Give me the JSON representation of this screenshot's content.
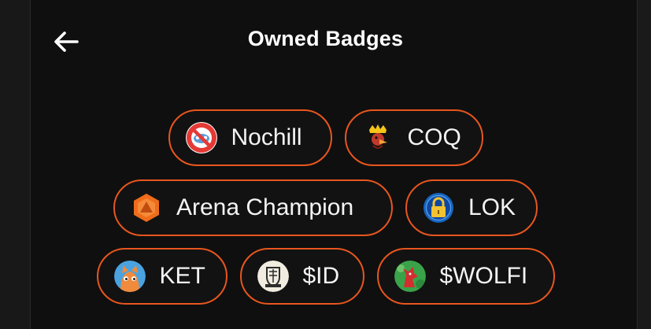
{
  "header": {
    "title": "Owned Badges",
    "back_icon": "arrow-left-icon"
  },
  "badges": [
    {
      "label": "Nochill",
      "icon": "nochill-logo-icon",
      "color": "#e53935"
    },
    {
      "label": "COQ",
      "icon": "crown-rooster-icon",
      "color": "#f5c518"
    },
    {
      "label": "Arena Champion",
      "icon": "arena-hexagon-icon",
      "color": "#ef6c1a"
    },
    {
      "label": "LOK",
      "icon": "padlock-icon",
      "color": "#1565c0"
    },
    {
      "label": "KET",
      "icon": "ket-mascot-icon",
      "color": "#4aa3df"
    },
    {
      "label": "$ID",
      "icon": "id-shield-logo-icon",
      "color": "#d9d2c0"
    },
    {
      "label": "$WOLFI",
      "icon": "wolfi-red-wolf-icon",
      "color": "#3aa34a"
    }
  ],
  "accent": "#e8561e",
  "background": "#0f0f0f"
}
